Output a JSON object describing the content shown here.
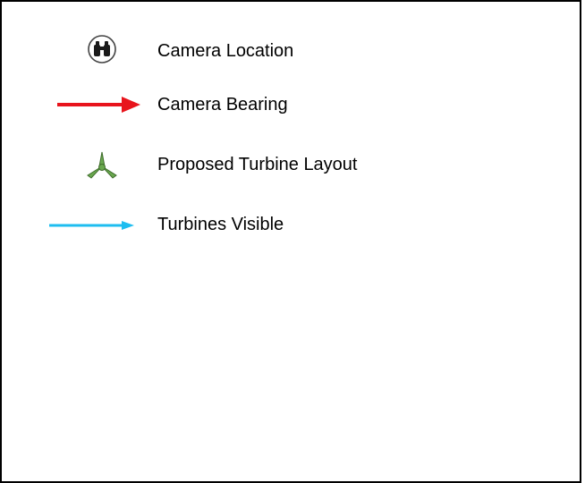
{
  "legend": {
    "items": [
      {
        "label": "Camera Location",
        "icon": "binoculars-icon"
      },
      {
        "label": "Camera Bearing",
        "icon": "red-arrow-icon",
        "color": "#e8141c"
      },
      {
        "label": "Proposed Turbine Layout",
        "icon": "turbine-icon",
        "color": "#6aa84f"
      },
      {
        "label": "Turbines Visible",
        "icon": "cyan-arrow-icon",
        "color": "#1ebdf0"
      }
    ]
  }
}
